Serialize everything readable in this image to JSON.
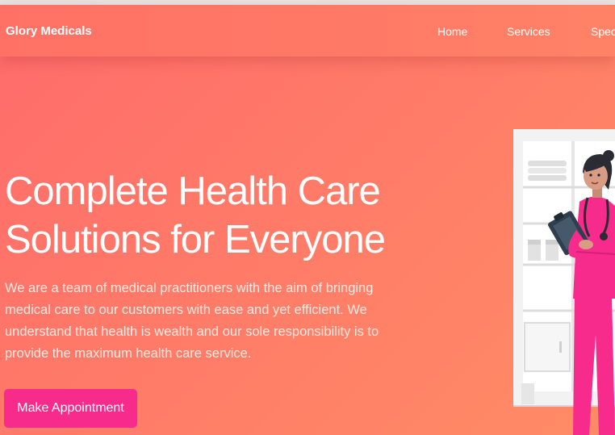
{
  "navbar": {
    "brand": "Glory Medicals",
    "links": [
      "Home",
      "Services",
      "Spec"
    ]
  },
  "hero": {
    "title_line1": "Complete Health Care",
    "title_line2": "Solutions for Everyone",
    "description": "We are a team of medical practitioners with the aim of bringing medical care to our customers with ease and yet efficient. We understand that health is wealth and our sole responsibility is to provide the maximum health care service.",
    "cta_label": "Make Appointment"
  },
  "colors": {
    "background_start": "#ff6b6b",
    "background_end": "#ff8c66",
    "cta": "#f72b8c",
    "scrubs": "#f72b8c"
  },
  "illustration": {
    "subject": "nurse-with-clipboard-illustration",
    "icon": "stethoscope-icon"
  }
}
